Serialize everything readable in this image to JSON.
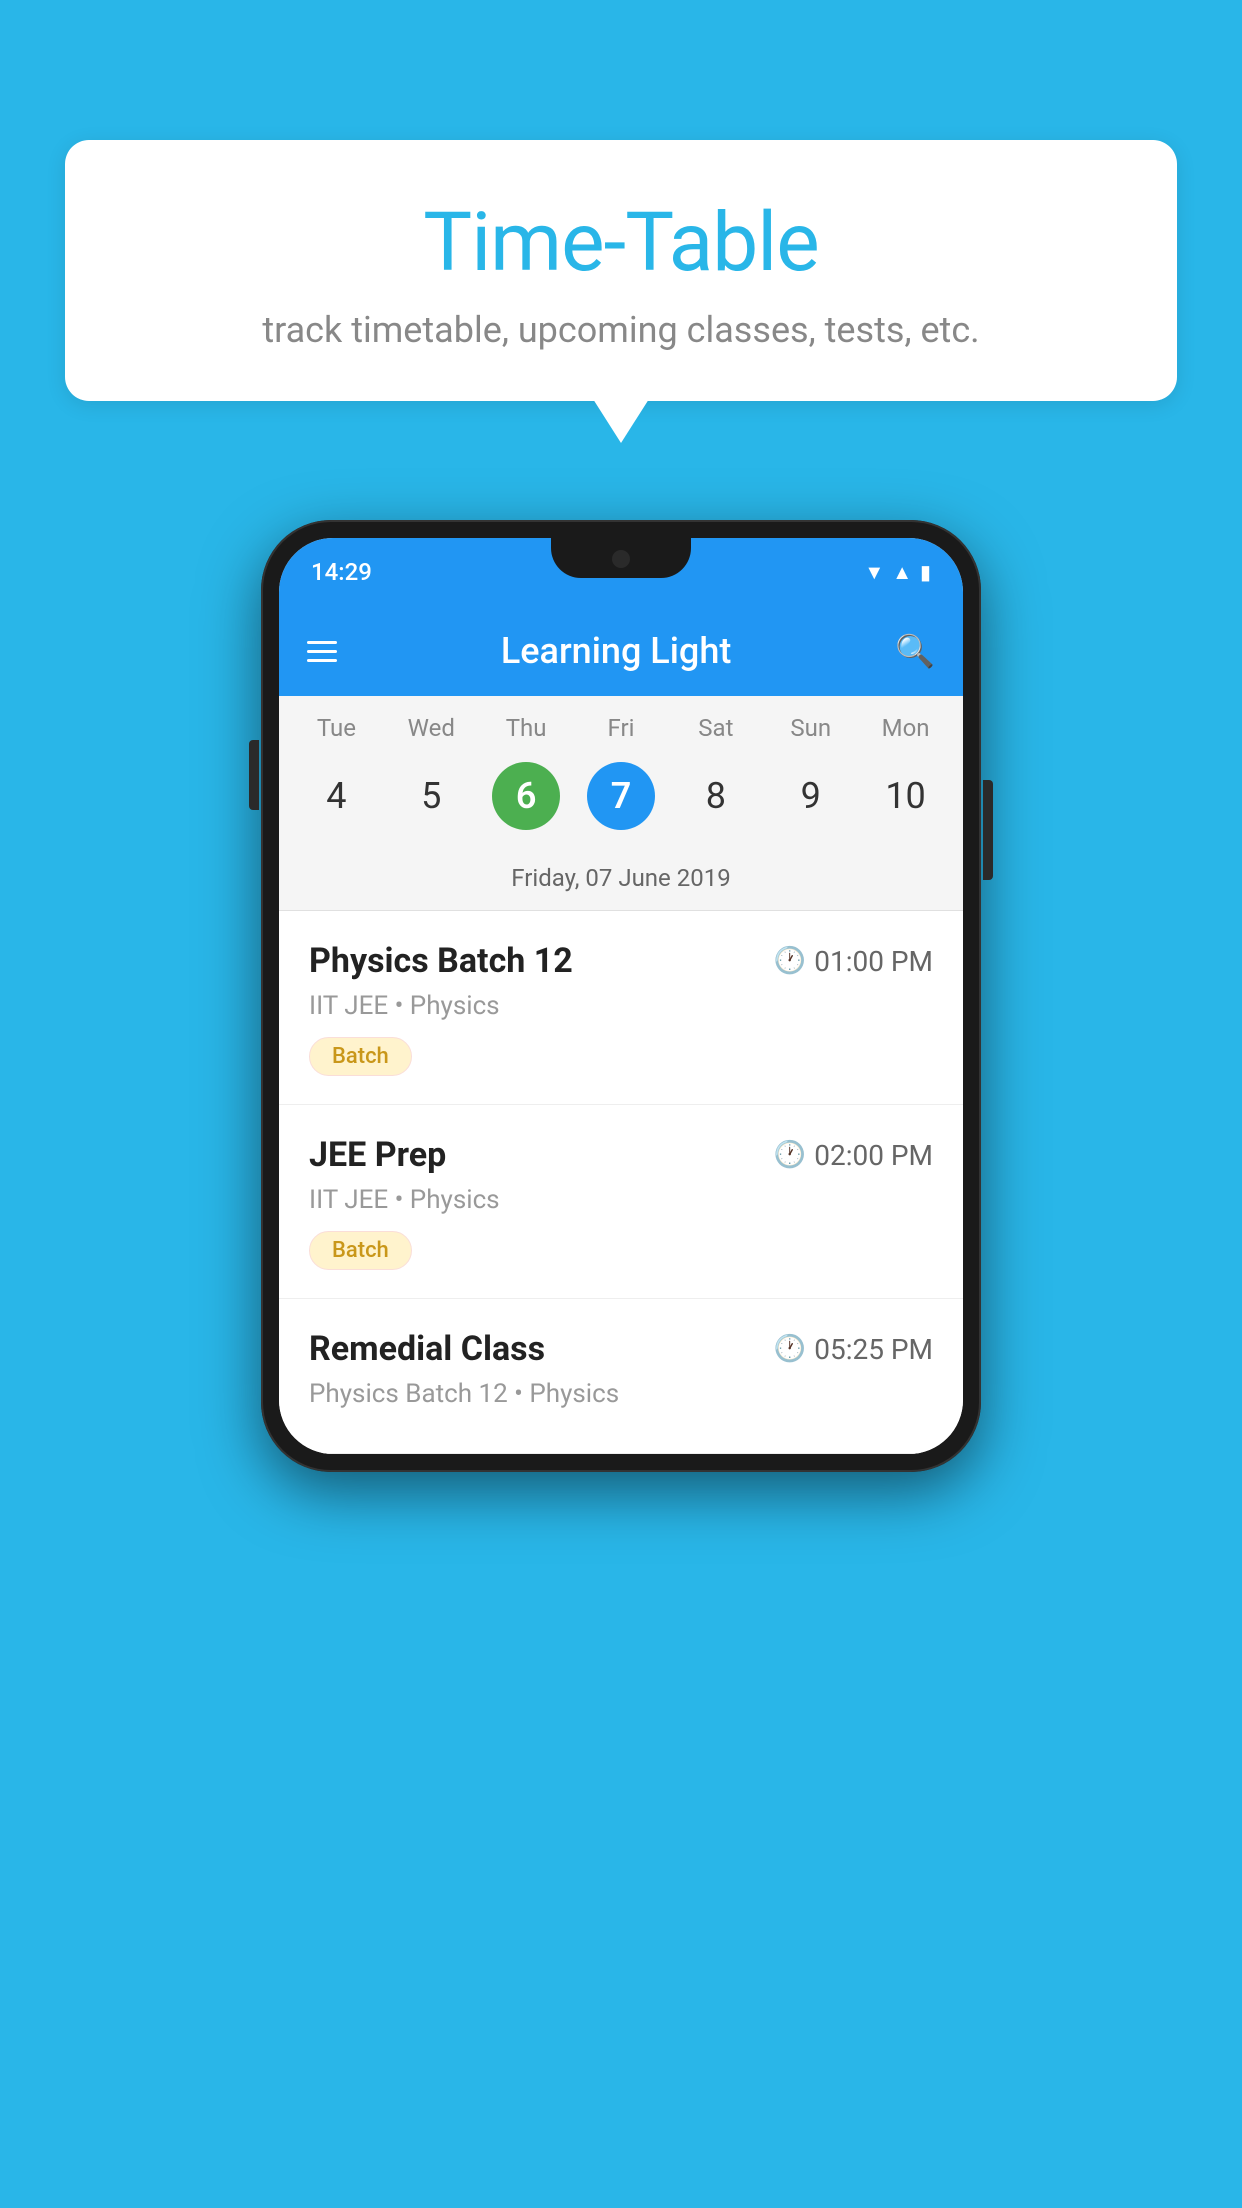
{
  "background_color": "#29B6E8",
  "speech_bubble": {
    "title": "Time-Table",
    "subtitle": "track timetable, upcoming classes, tests, etc."
  },
  "phone": {
    "status_bar": {
      "time": "14:29"
    },
    "app_bar": {
      "title": "Learning Light"
    },
    "calendar": {
      "days": [
        "Tue",
        "Wed",
        "Thu",
        "Fri",
        "Sat",
        "Sun",
        "Mon"
      ],
      "dates": [
        "4",
        "5",
        "6",
        "7",
        "8",
        "9",
        "10"
      ],
      "today_index": 2,
      "selected_index": 3,
      "selected_date_label": "Friday, 07 June 2019"
    },
    "schedule": [
      {
        "title": "Physics Batch 12",
        "time": "01:00 PM",
        "subtitle": "IIT JEE • Physics",
        "badge": "Batch"
      },
      {
        "title": "JEE Prep",
        "time": "02:00 PM",
        "subtitle": "IIT JEE • Physics",
        "badge": "Batch"
      },
      {
        "title": "Remedial Class",
        "time": "05:25 PM",
        "subtitle": "Physics Batch 12 • Physics",
        "badge": null
      }
    ]
  }
}
